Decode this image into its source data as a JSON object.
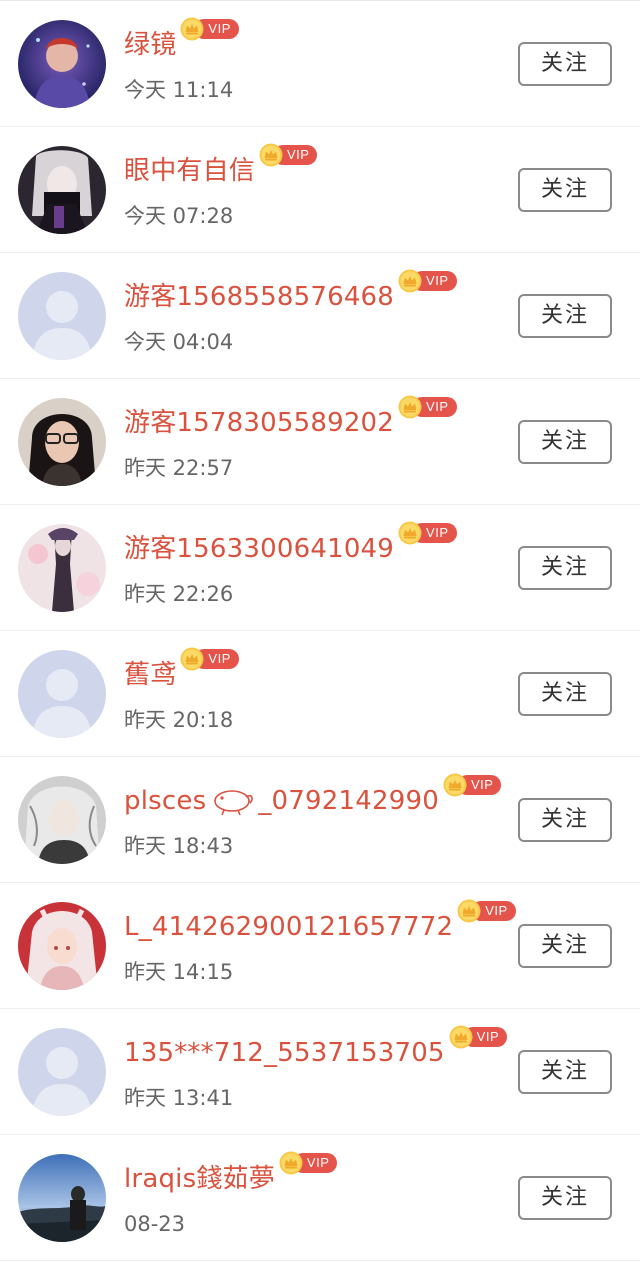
{
  "follow_label": "关注",
  "vip_label": "VIP",
  "colors": {
    "name": "#d9523e",
    "vip_badge": "#e4544a",
    "time": "#666666",
    "button_border": "#8a8a8a"
  },
  "users": [
    {
      "name": "绿镜",
      "time": "今天 11:14",
      "avatar": "photo-avatar"
    },
    {
      "name": "眼中有自信",
      "time": "今天 07:28",
      "avatar": "photo-avatar"
    },
    {
      "name": "游客1568558576468",
      "time": "今天 04:04",
      "avatar": "default-avatar"
    },
    {
      "name": "游客1578305589202",
      "time": "昨天 22:57",
      "avatar": "photo-avatar"
    },
    {
      "name": "游客1563300641049",
      "time": "昨天 22:26",
      "avatar": "photo-avatar"
    },
    {
      "name": "舊鸢",
      "time": "昨天 20:18",
      "avatar": "default-avatar"
    },
    {
      "name_prefix": "plsces",
      "name_icon": "seal-doodle-icon",
      "name_suffix": "_0792142990",
      "time": "昨天 18:43",
      "avatar": "photo-avatar"
    },
    {
      "name": "L_414262900121657772",
      "time": "昨天 14:15",
      "avatar": "photo-avatar"
    },
    {
      "name": "135***712_5537153705",
      "time": "昨天 13:41",
      "avatar": "default-avatar"
    },
    {
      "name": "lraqis錢茹夢",
      "time": "08-23",
      "avatar": "photo-avatar"
    }
  ]
}
